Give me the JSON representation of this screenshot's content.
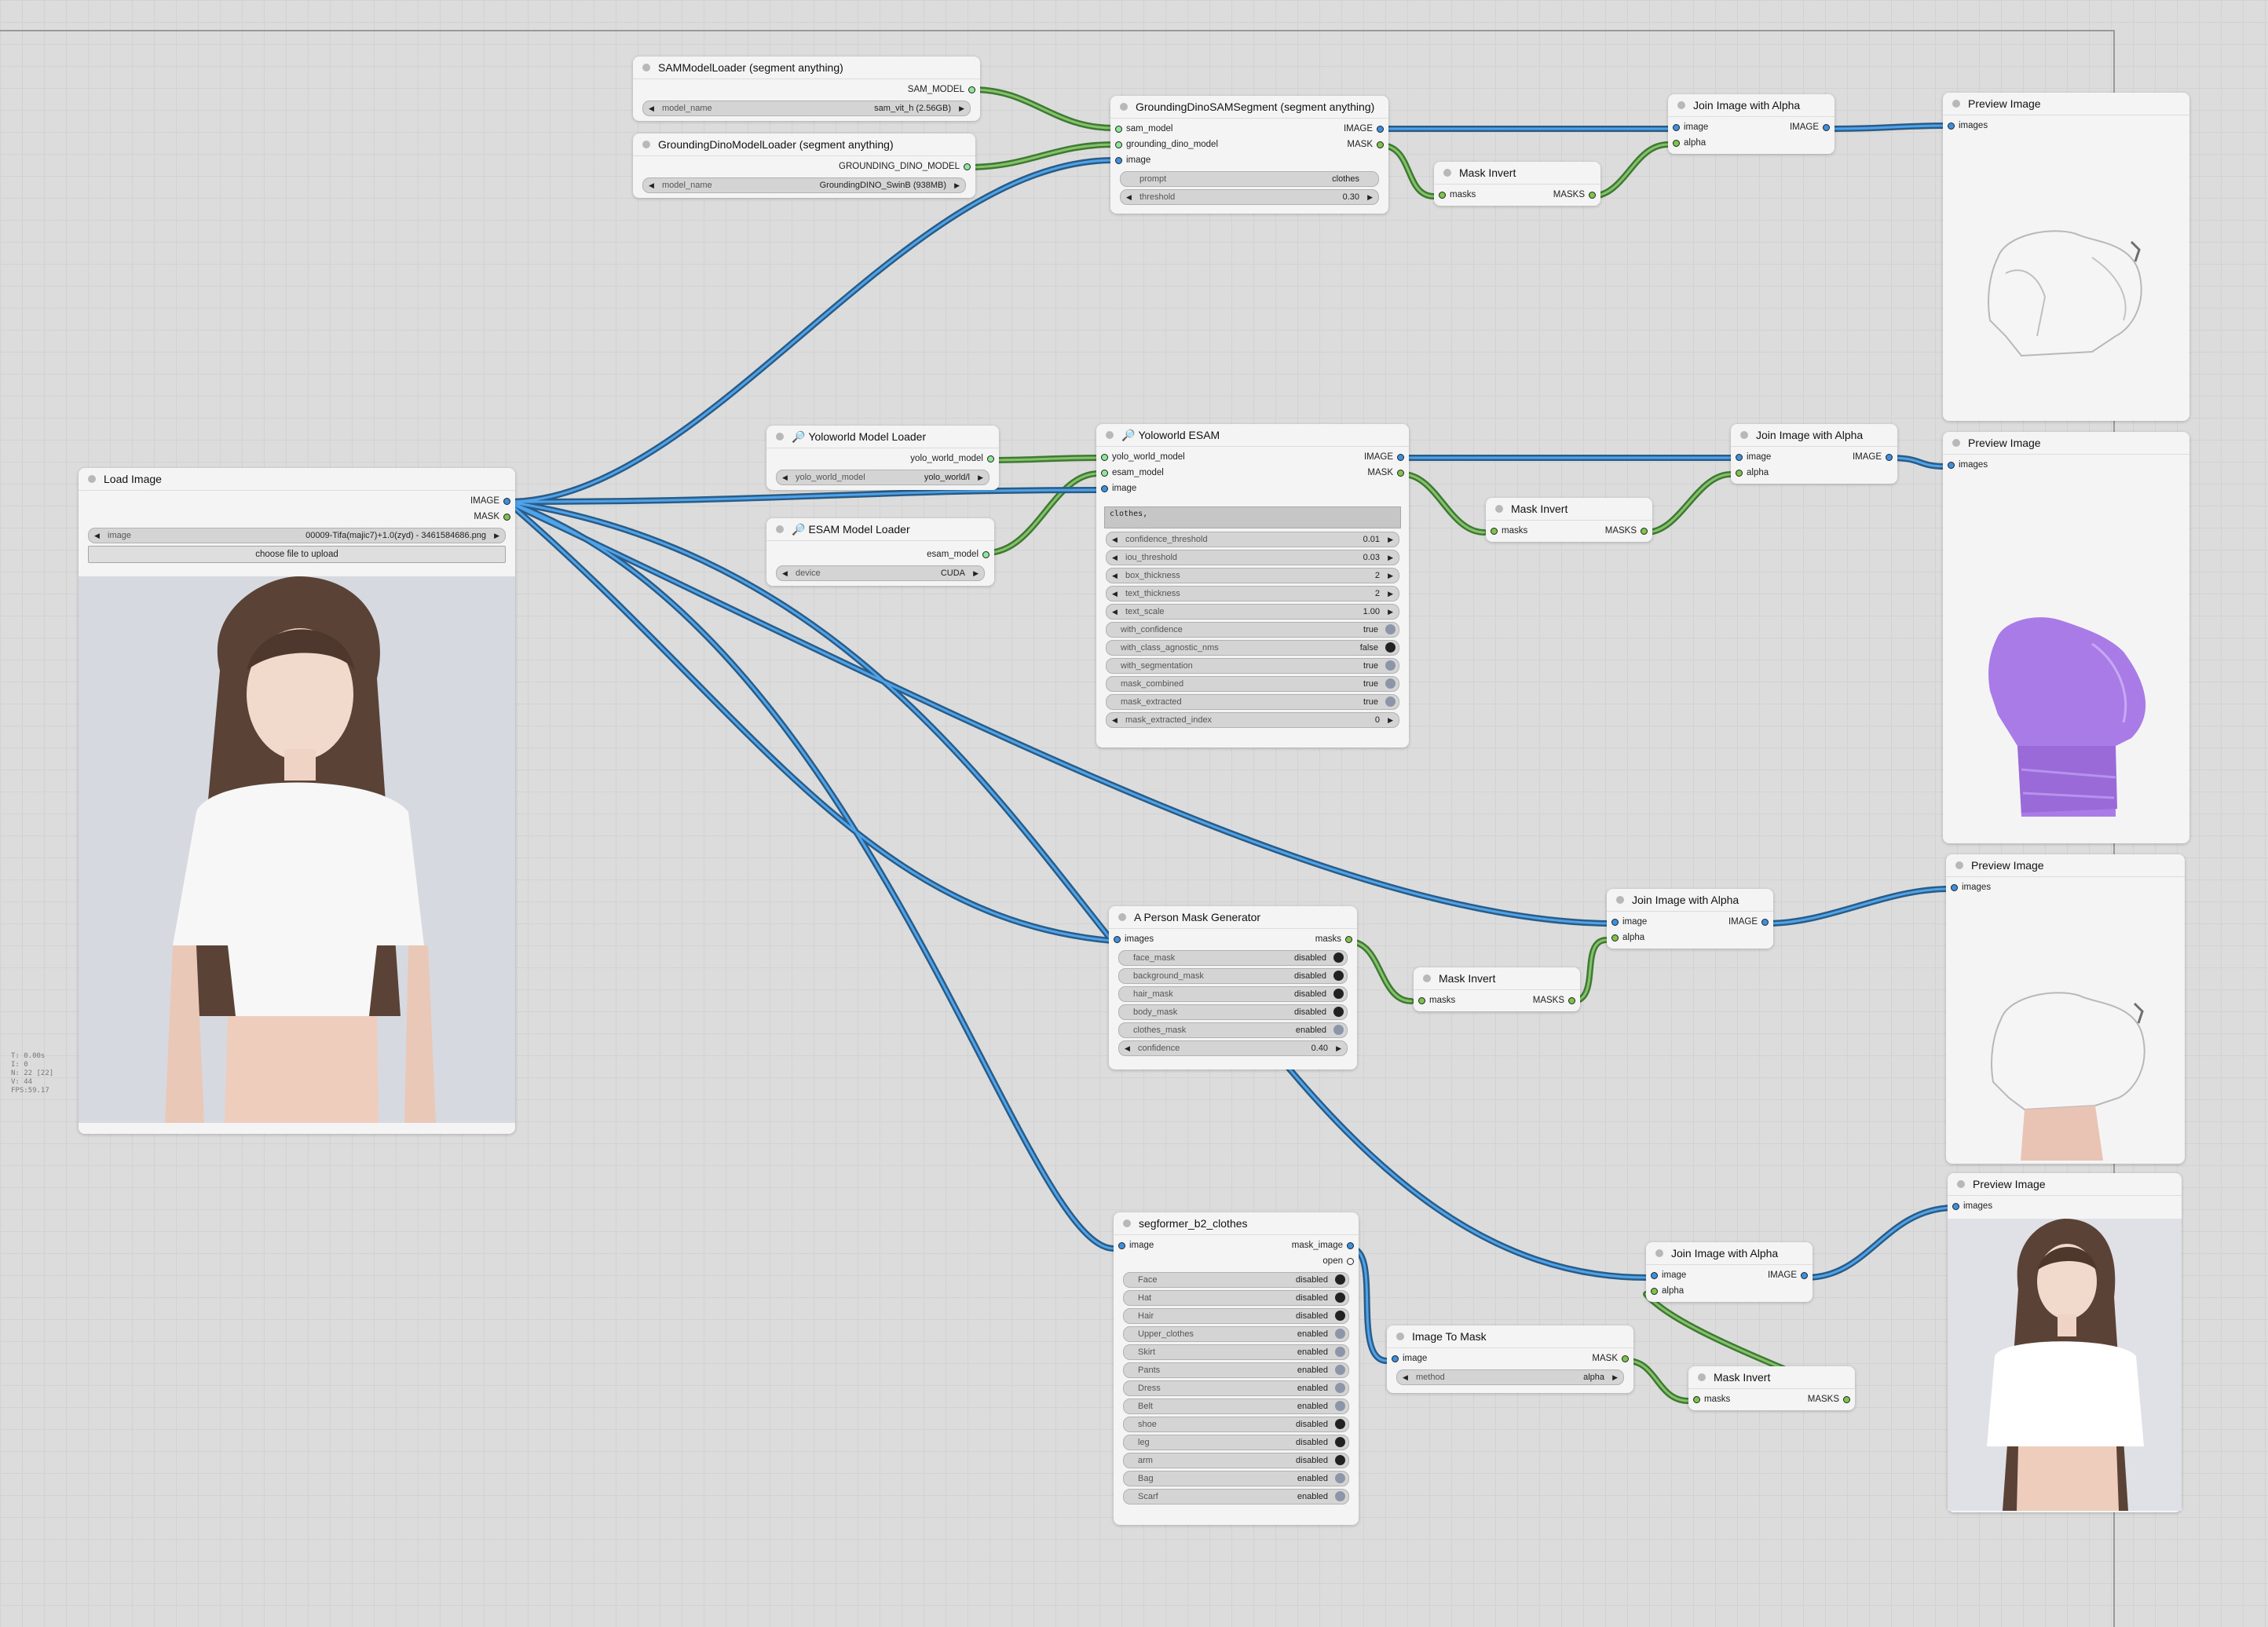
{
  "stats": {
    "lines": [
      "T: 0.00s",
      "I: 0",
      "N: 22 [22]",
      "V: 44",
      "FPS:59.17"
    ]
  },
  "nodes": {
    "load_image": {
      "title": "Load Image",
      "out1": "IMAGE",
      "out2": "MASK",
      "w_image_label": "image",
      "w_image_value": "00009-Tifa(majic7)+1.0(zyd) - 3461584686.png",
      "upload": "choose file to upload"
    },
    "sam_loader": {
      "title": "SAMModelLoader (segment anything)",
      "out1": "SAM_MODEL",
      "w_label": "model_name",
      "w_value": "sam_vit_h (2.56GB)"
    },
    "gdino_loader": {
      "title": "GroundingDinoModelLoader (segment anything)",
      "out1": "GROUNDING_DINO_MODEL",
      "w_label": "model_name",
      "w_value": "GroundingDINO_SwinB (938MB)"
    },
    "gdsam": {
      "title": "GroundingDinoSAMSegment (segment anything)",
      "in1": "sam_model",
      "in2": "grounding_dino_model",
      "in3": "image",
      "out1": "IMAGE",
      "out2": "MASK",
      "w1_label": "prompt",
      "w1_value": "clothes",
      "w2_label": "threshold",
      "w2_value": "0.30"
    },
    "mi1": {
      "title": "Mask Invert",
      "in1": "masks",
      "out1": "MASKS"
    },
    "ja1": {
      "title": "Join Image with Alpha",
      "in1": "image",
      "in2": "alpha",
      "out1": "IMAGE"
    },
    "pv1": {
      "title": "Preview Image",
      "in1": "images"
    },
    "yw_loader": {
      "title": "Yoloworld Model Loader",
      "out1": "yolo_world_model",
      "w_label": "yolo_world_model",
      "w_value": "yolo_world/l"
    },
    "esam_loader": {
      "title": "ESAM Model Loader",
      "out1": "esam_model",
      "w_label": "device",
      "w_value": "CUDA"
    },
    "yw_esam": {
      "title": "Yoloworld ESAM",
      "in1": "yolo_world_model",
      "in2": "esam_model",
      "in3": "image",
      "out1": "IMAGE",
      "out2": "MASK",
      "prompt": "clothes,",
      "w1_label": "confidence_threshold",
      "w1_value": "0.01",
      "w2_label": "iou_threshold",
      "w2_value": "0.03",
      "w3_label": "box_thickness",
      "w3_value": "2",
      "w4_label": "text_thickness",
      "w4_value": "2",
      "w5_label": "text_scale",
      "w5_value": "1.00",
      "t1_label": "with_confidence",
      "t1_value": "true",
      "t2_label": "with_class_agnostic_nms",
      "t2_value": "false",
      "t3_label": "with_segmentation",
      "t3_value": "true",
      "t4_label": "mask_combined",
      "t4_value": "true",
      "t5_label": "mask_extracted",
      "t5_value": "true",
      "w6_label": "mask_extracted_index",
      "w6_value": "0"
    },
    "mi2": {
      "title": "Mask Invert",
      "in1": "masks",
      "out1": "MASKS"
    },
    "ja2": {
      "title": "Join Image with Alpha",
      "in1": "image",
      "in2": "alpha",
      "out1": "IMAGE"
    },
    "pv2": {
      "title": "Preview Image",
      "in1": "images"
    },
    "pmg": {
      "title": "A Person Mask Generator",
      "in1": "images",
      "out1": "masks",
      "t1_label": "face_mask",
      "t1_value": "disabled",
      "t2_label": "background_mask",
      "t2_value": "disabled",
      "t3_label": "hair_mask",
      "t3_value": "disabled",
      "t4_label": "body_mask",
      "t4_value": "disabled",
      "t5_label": "clothes_mask",
      "t5_value": "enabled",
      "w1_label": "confidence",
      "w1_value": "0.40"
    },
    "mi3": {
      "title": "Mask Invert",
      "in1": "masks",
      "out1": "MASKS"
    },
    "ja3": {
      "title": "Join Image with Alpha",
      "in1": "image",
      "in2": "alpha",
      "out1": "IMAGE"
    },
    "pv3": {
      "title": "Preview Image",
      "in1": "images"
    },
    "seg": {
      "title": "segformer_b2_clothes",
      "in1": "image",
      "out1": "mask_image",
      "out2": "open",
      "items": [
        {
          "label": "Face",
          "value": "disabled"
        },
        {
          "label": "Hat",
          "value": "disabled"
        },
        {
          "label": "Hair",
          "value": "disabled"
        },
        {
          "label": "Upper_clothes",
          "value": "enabled"
        },
        {
          "label": "Skirt",
          "value": "enabled"
        },
        {
          "label": "Pants",
          "value": "enabled"
        },
        {
          "label": "Dress",
          "value": "enabled"
        },
        {
          "label": "Belt",
          "value": "enabled"
        },
        {
          "label": "shoe",
          "value": "disabled"
        },
        {
          "label": "leg",
          "value": "disabled"
        },
        {
          "label": "arm",
          "value": "disabled"
        },
        {
          "label": "Bag",
          "value": "enabled"
        },
        {
          "label": "Scarf",
          "value": "enabled"
        }
      ]
    },
    "itm": {
      "title": "Image To Mask",
      "in1": "image",
      "out1": "MASK",
      "w_label": "method",
      "w_value": "alpha"
    },
    "ja4": {
      "title": "Join Image with Alpha",
      "in1": "image",
      "in2": "alpha",
      "out1": "IMAGE"
    },
    "mi4": {
      "title": "Mask Invert",
      "in1": "masks",
      "out1": "MASKS"
    },
    "pv4": {
      "title": "Preview Image",
      "in1": "images"
    }
  }
}
